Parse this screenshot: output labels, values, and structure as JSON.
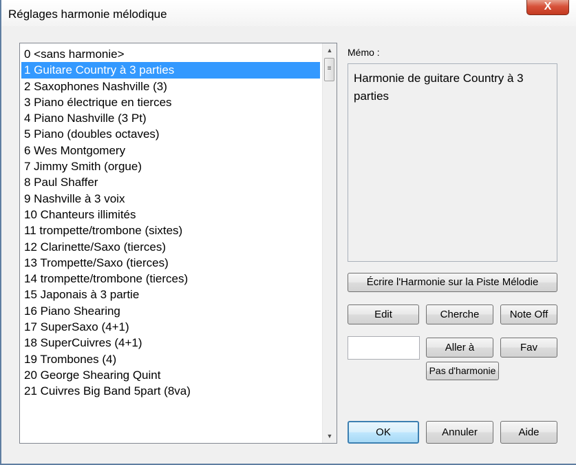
{
  "window": {
    "title": "Réglages harmonie mélodique",
    "close_label": "X"
  },
  "list": {
    "items": [
      {
        "label": "0 <sans harmonie>",
        "selected": false
      },
      {
        "label": "1 Guitare Country à 3 parties",
        "selected": true
      },
      {
        "label": "2 Saxophones Nashville (3)",
        "selected": false
      },
      {
        "label": "3 Piano électrique en tierces",
        "selected": false
      },
      {
        "label": "4 Piano Nashville (3 Pt)",
        "selected": false
      },
      {
        "label": "5 Piano (doubles octaves)",
        "selected": false
      },
      {
        "label": "6 Wes Montgomery",
        "selected": false
      },
      {
        "label": "7 Jimmy Smith (orgue)",
        "selected": false
      },
      {
        "label": "8 Paul Shaffer",
        "selected": false
      },
      {
        "label": "9 Nashville à 3 voix",
        "selected": false
      },
      {
        "label": "10 Chanteurs illimités",
        "selected": false
      },
      {
        "label": "11 trompette/trombone (sixtes)",
        "selected": false
      },
      {
        "label": "12 Clarinette/Saxo (tierces)",
        "selected": false
      },
      {
        "label": "13 Trompette/Saxo (tierces)",
        "selected": false
      },
      {
        "label": "14 trompette/trombone (tierces)",
        "selected": false
      },
      {
        "label": "15 Japonais à 3 partie",
        "selected": false
      },
      {
        "label": "16 Piano Shearing",
        "selected": false
      },
      {
        "label": "17 SuperSaxo (4+1)",
        "selected": false
      },
      {
        "label": "18 SuperCuivres (4+1)",
        "selected": false
      },
      {
        "label": "19 Trombones (4)",
        "selected": false
      },
      {
        "label": "20 George Shearing Quint",
        "selected": false
      },
      {
        "label": "21 Cuivres Big Band 5part (8va)",
        "selected": false
      }
    ]
  },
  "memo": {
    "label": "Mémo :",
    "text": "Harmonie de guitare Country à 3 parties"
  },
  "buttons": {
    "write": "Écrire l'Harmonie sur la Piste Mélodie",
    "edit": "Edit",
    "search": "Cherche",
    "note_off": "Note Off",
    "goto": "Aller à",
    "fav": "Fav",
    "no_harmony": "Pas d'harmonie",
    "ok": "OK",
    "cancel": "Annuler",
    "help": "Aide"
  },
  "goto_input": {
    "value": ""
  },
  "colors": {
    "selection": "#3399ff",
    "window_border": "#5f7ea1",
    "close_button": "#c33a20"
  }
}
